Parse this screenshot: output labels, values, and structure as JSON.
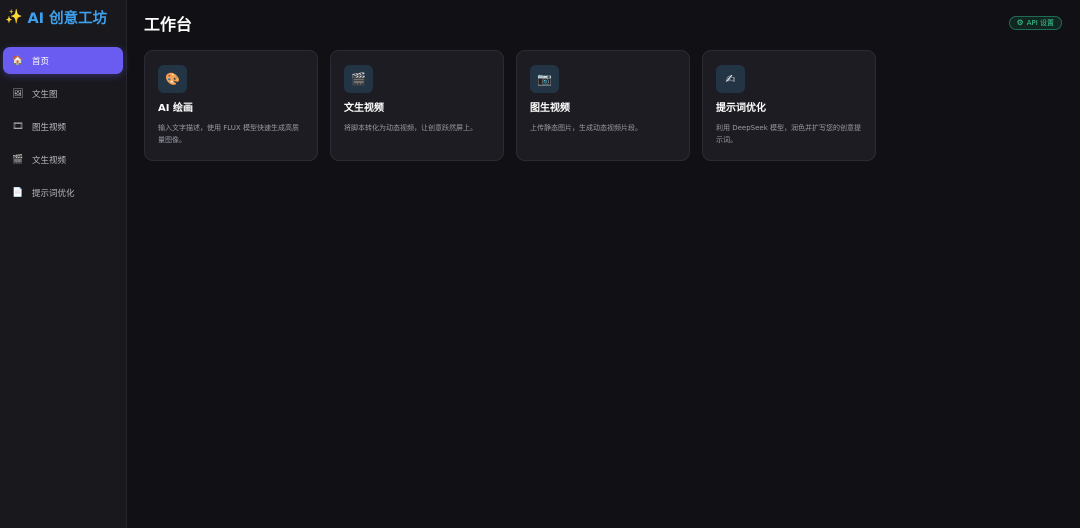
{
  "app": {
    "brand_icon": "✨",
    "brand_name": "AI 创意工坊"
  },
  "sidebar": {
    "items": [
      {
        "label": "首页",
        "icon": "🏠",
        "icon_name": "home-icon",
        "active": true
      },
      {
        "label": "文生图",
        "icon": "🖼",
        "icon_name": "image-icon",
        "active": false
      },
      {
        "label": "图生视频",
        "icon": "🎞",
        "icon_name": "film-icon",
        "active": false
      },
      {
        "label": "文生视频",
        "icon": "🎬",
        "icon_name": "clapper-icon",
        "active": false
      },
      {
        "label": "提示词优化",
        "icon": "📄",
        "icon_name": "document-icon",
        "active": false
      }
    ]
  },
  "header": {
    "title": "工作台",
    "api_button": {
      "icon": "⚙",
      "label": "API 设置"
    }
  },
  "cards": [
    {
      "icon": "🎨",
      "icon_name": "palette-icon",
      "title": "AI 绘画",
      "desc": "输入文字描述，使用 FLUX 模型快速生成高质量图像。"
    },
    {
      "icon": "🎬",
      "icon_name": "clapper-icon",
      "title": "文生视频",
      "desc": "将脚本转化为动态视频，让创意跃然屏上。"
    },
    {
      "icon": "📷",
      "icon_name": "camera-icon",
      "title": "图生视频",
      "desc": "上传静态图片，生成动态视频片段。"
    },
    {
      "icon": "✍",
      "icon_name": "writing-hand-icon",
      "title": "提示词优化",
      "desc": "利用 DeepSeek 模型，润色并扩写您的创意提示词。"
    }
  ],
  "colors": {
    "accent": "#6a5cf0",
    "brand": "#3fa0ee",
    "success": "#3ecf9c",
    "background": "#111115",
    "sidebar": "#18181d",
    "card": "#1c1c22"
  }
}
